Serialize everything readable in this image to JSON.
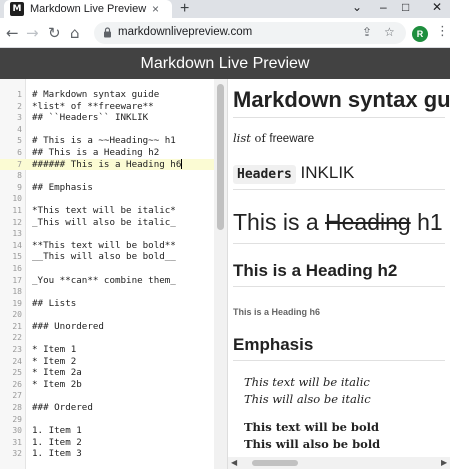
{
  "browser": {
    "tab_title": "Markdown Live Preview",
    "favicon_letter": "M",
    "tab_close": "×",
    "new_tab": "+",
    "window_controls": [
      "⌄",
      "–",
      "□",
      "✕"
    ],
    "url": "markdownlivepreview.com",
    "profile_initial": "R",
    "nav": {
      "back": "←",
      "forward": "→",
      "reload": "↻",
      "home": "⌂"
    },
    "omni_icons": {
      "share": "⇪",
      "bookmark": "☆"
    },
    "menu": "⋮"
  },
  "app": {
    "title": "Markdown Live Preview"
  },
  "editor": {
    "lines": [
      {
        "n": "1",
        "text": "# Markdown syntax guide"
      },
      {
        "n": "2",
        "text": "*list* of **freeware**"
      },
      {
        "n": "3",
        "text": "## ``Headers`` INKLIK"
      },
      {
        "n": "4",
        "text": ""
      },
      {
        "n": "5",
        "text": "# This is a ~~Heading~~ h1"
      },
      {
        "n": "6",
        "text": "## This is a Heading h2"
      },
      {
        "n": "7",
        "text": "###### This is a Heading h6"
      },
      {
        "n": "8",
        "text": ""
      },
      {
        "n": "9",
        "text": "## Emphasis"
      },
      {
        "n": "10",
        "text": ""
      },
      {
        "n": "11",
        "text": "*This text will be italic*"
      },
      {
        "n": "12",
        "text": "_This will also be italic_"
      },
      {
        "n": "13",
        "text": ""
      },
      {
        "n": "14",
        "text": "**This text will be bold**"
      },
      {
        "n": "15",
        "text": "__This will also be bold__"
      },
      {
        "n": "16",
        "text": ""
      },
      {
        "n": "17",
        "text": "_You **can** combine them_"
      },
      {
        "n": "18",
        "text": ""
      },
      {
        "n": "19",
        "text": "## Lists"
      },
      {
        "n": "20",
        "text": ""
      },
      {
        "n": "21",
        "text": "### Unordered"
      },
      {
        "n": "22",
        "text": ""
      },
      {
        "n": "23",
        "text": "* Item 1"
      },
      {
        "n": "24",
        "text": "* Item 2"
      },
      {
        "n": "25",
        "text": "* Item 2a"
      },
      {
        "n": "26",
        "text": "* Item 2b"
      },
      {
        "n": "27",
        "text": ""
      },
      {
        "n": "28",
        "text": "### Ordered"
      },
      {
        "n": "29",
        "text": ""
      },
      {
        "n": "30",
        "text": "1. Item 1"
      },
      {
        "n": "31",
        "text": "1. Item 2"
      },
      {
        "n": "32",
        "text": "1. Item 3"
      }
    ]
  },
  "preview": {
    "h1": "Markdown syntax guide",
    "list_word": "list",
    "of_word": " of ",
    "freeware": "freeware",
    "headers_code": "Headers",
    "inklik": "INKLIK",
    "h1b_prefix": "This is a ",
    "h1b_strike": "Heading",
    "h1b_suffix": " h1",
    "h2": "This is a Heading h2",
    "h6": "This is a Heading h6",
    "emphasis": "Emphasis",
    "italic1": "This text will be italic",
    "italic2": "This will also be italic",
    "bold1": "This text will be bold",
    "bold2": "This will also be bold"
  },
  "colors": {
    "app_header": "#424242",
    "active_line": "#fbfbd3",
    "avatar": "#1e8e3e"
  }
}
